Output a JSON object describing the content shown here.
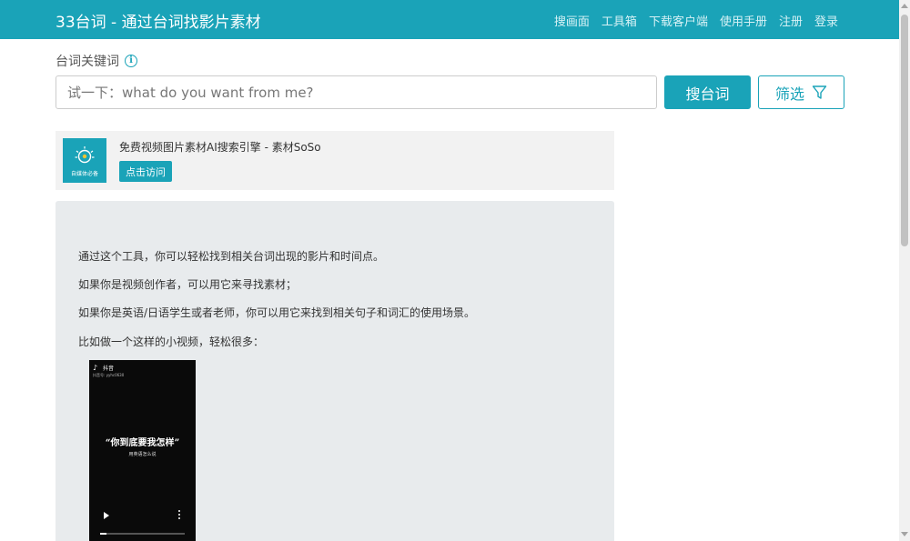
{
  "navbar": {
    "brand": "33台词 - 通过台词找影片素材",
    "links": [
      "搜画面",
      "工具箱",
      "下载客户端",
      "使用手册",
      "注册",
      "登录"
    ]
  },
  "search": {
    "label": "台词关键词",
    "info_icon": "i",
    "placeholder": "试一下：what do you want from me?",
    "value": "",
    "search_button": "搜台词",
    "filter_button": "筛选"
  },
  "ad": {
    "logo_text": "自媒体必备",
    "title": "免费视频图片素材AI搜索引擎 - 素材SoSo",
    "visit_button": "点击访问"
  },
  "intro": {
    "paragraphs": [
      "通过这个工具，你可以轻松找到相关台词出现的影片和时间点。",
      "如果你是视频创作者，可以用它来寻找素材；",
      "如果你是英语/日语学生或者老师，你可以用它来找到相关句子和词汇的使用场景。",
      "比如做一个这样的小视频，轻松很多："
    ]
  },
  "video": {
    "app_name": "抖音",
    "account_id": "抖音号: yyhc0630",
    "caption": "“你到底要我怎样”",
    "subcaption": "用英语怎么说",
    "progress": 0.07
  },
  "colors": {
    "accent": "#1aa3b8",
    "ad_background": "#f2f2f2",
    "panel_background": "#e8ebed"
  },
  "icons": {
    "filter": "funnel-icon",
    "info": "info-circle-icon",
    "play": "play-icon",
    "more": "more-vertical-icon"
  }
}
